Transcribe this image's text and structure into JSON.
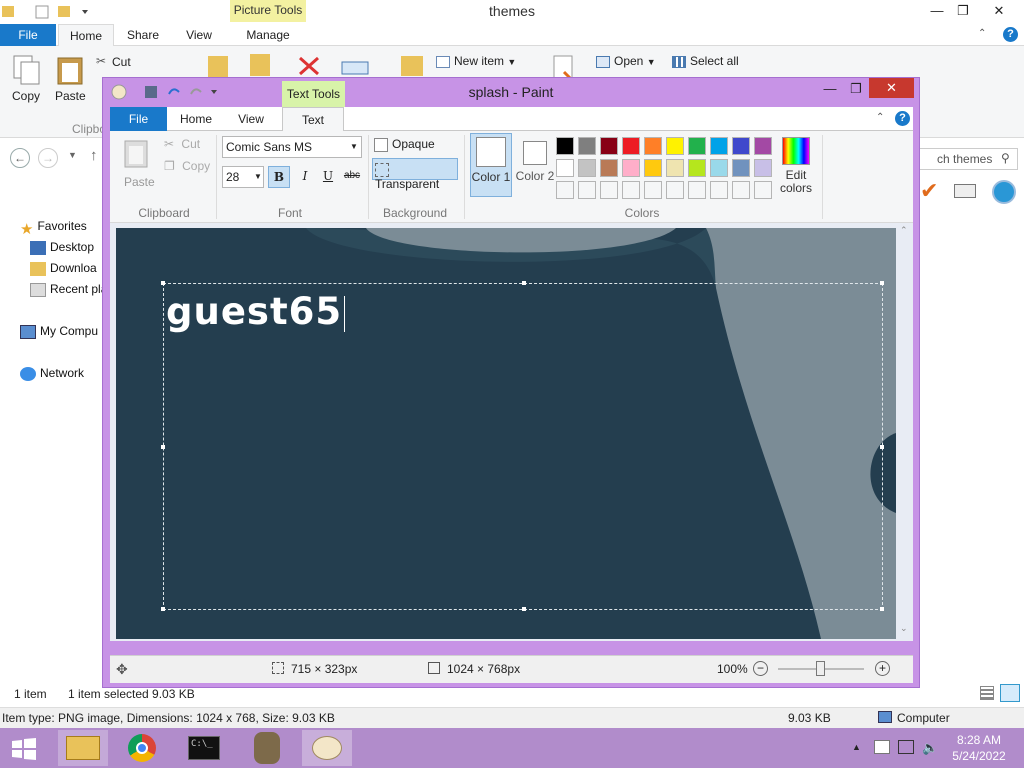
{
  "explorer": {
    "title": "themes",
    "picture_tools": "Picture Tools",
    "tabs": {
      "file": "File",
      "home": "Home",
      "share": "Share",
      "view": "View",
      "manage": "Manage"
    },
    "ribbon": {
      "copy": "Copy",
      "paste": "Paste",
      "cut": "Cut",
      "clipboard_group": "Clipbo",
      "new_item": "New item",
      "open": "Open",
      "select_all": "Select all"
    },
    "search_placeholder": "ch themes",
    "nav": {
      "favorites": "Favorites",
      "desktop": "Desktop",
      "downloads": "Downloa",
      "recent": "Recent pla",
      "computer": "My Compu",
      "network": "Network"
    },
    "status": {
      "items": "1 item",
      "selected": "1 item selected  9.03 KB"
    },
    "details": {
      "item_type": "Item type: PNG image, Dimensions: 1024 x 768, Size: 9.03 KB",
      "size": "9.03 KB",
      "computer": "Computer"
    }
  },
  "paint": {
    "title": "splash - Paint",
    "text_tools": "Text Tools",
    "tabs": {
      "file": "File",
      "home": "Home",
      "view": "View",
      "text": "Text"
    },
    "clipboard": {
      "paste": "Paste",
      "cut": "Cut",
      "copy": "Copy",
      "group": "Clipboard"
    },
    "font": {
      "family": "Comic Sans MS",
      "size": "28",
      "bold": "B",
      "italic": "I",
      "underline": "U",
      "strike": "abc",
      "group": "Font"
    },
    "background": {
      "opaque": "Opaque",
      "transparent": "Transparent",
      "group": "Background"
    },
    "colors": {
      "color1": "Color 1",
      "color2": "Color 2",
      "edit": "Edit colors",
      "group": "Colors",
      "row1": [
        "#000000",
        "#7f7f7f",
        "#880015",
        "#ed1c24",
        "#ff7f27",
        "#fff200",
        "#22b14c",
        "#00a2e8",
        "#3f48cc",
        "#a349a4"
      ],
      "row2": [
        "#ffffff",
        "#c3c3c3",
        "#b97a57",
        "#ffaec9",
        "#ffc90e",
        "#efe4b0",
        "#b5e61d",
        "#99d9ea",
        "#7092be",
        "#c8bfe7"
      ]
    },
    "canvas_text": "guest65",
    "status": {
      "selection_size": "715 × 323px",
      "image_size": "1024 × 768px",
      "zoom": "100%"
    }
  },
  "taskbar": {
    "time": "8:28 AM",
    "date": "5/24/2022"
  },
  "theme": {
    "paint_frame": "#c793e6",
    "explorer_file_tab": "#1979ca",
    "close_button": "#c7382e"
  }
}
